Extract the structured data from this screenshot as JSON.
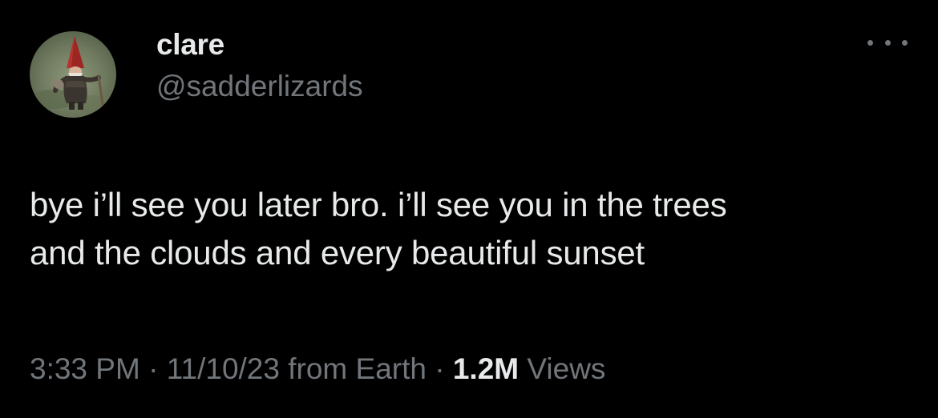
{
  "user": {
    "display_name": "clare",
    "handle": "@sadderlizards",
    "avatar_icon": "gnome-avatar-icon"
  },
  "actions": {
    "more_icon": "more-options-icon"
  },
  "tweet": {
    "text_lines": [
      "bye i’ll see you later bro. i’ll see you in the trees",
      "and the clouds and every beautiful sunset"
    ]
  },
  "meta": {
    "time": "3:33 PM",
    "separator": " · ",
    "date": "11/10/23",
    "source": "from Earth",
    "views_count": "1.2M",
    "views_label": "Views"
  },
  "colors": {
    "background": "#000000",
    "primary_text": "#e7e9ea",
    "secondary_text": "#71767b"
  }
}
